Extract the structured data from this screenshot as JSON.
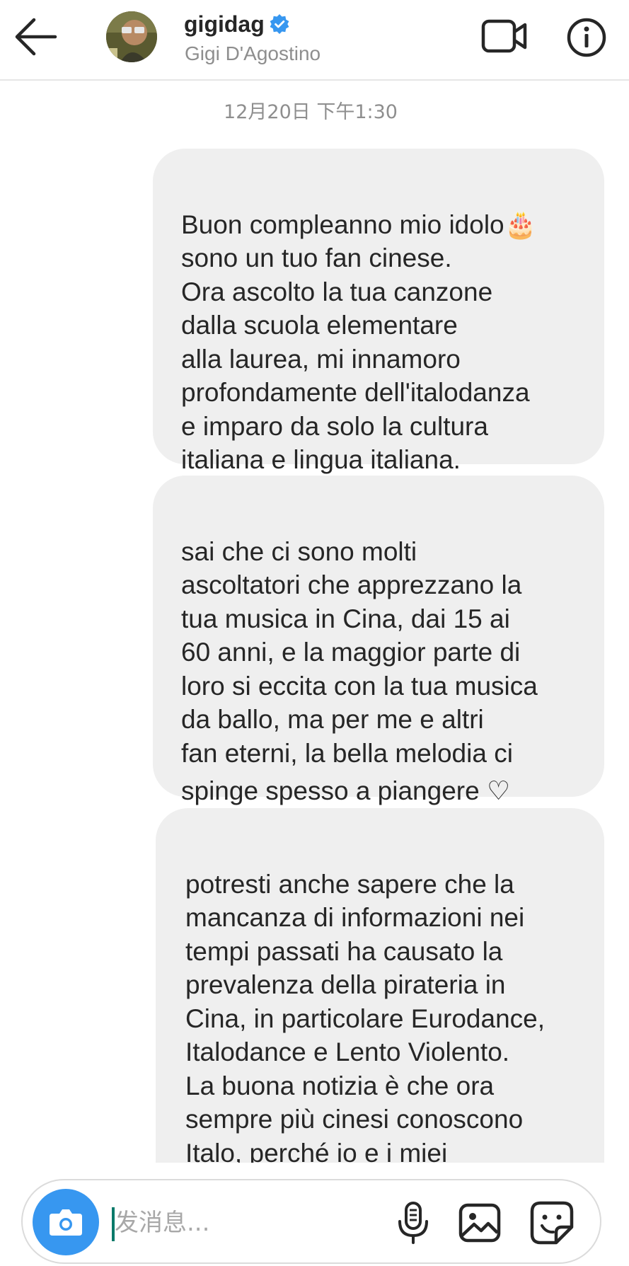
{
  "header": {
    "username": "gigidag",
    "full_name": "Gigi D'Agostino",
    "verified": true,
    "icons": {
      "back": "arrow-left-icon",
      "verified": "verified-badge-icon",
      "video_call": "video-camera-icon",
      "info": "info-icon"
    }
  },
  "thread": {
    "timestamp": "12月20日 下午1:30",
    "messages": [
      {
        "sender": "me",
        "text": "Buon compleanno mio idolo🎂\nsono un tuo fan cinese.\nOra ascolto la tua canzone\ndalla scuola elementare\nalla laurea, mi innamoro\nprofondamente dell'italodanza\ne imparo da solo la cultura\nitaliana e lingua italiana."
      },
      {
        "sender": "me",
        "text": "sai che ci sono molti\nascoltatori che apprezzano la\ntua musica in Cina, dai 15 ai\n60 anni, e la maggior parte di\nloro si eccita con la tua musica\nda ballo, ma per me e altri\nfan eterni, la bella melodia ci",
        "last_line": "spinge spesso a piangere ♡"
      },
      {
        "sender": "me",
        "text": "potresti anche sapere che la\nmancanza di informazioni nei\ntempi passati ha causato la\nprevalenza della pirateria in\nCina, in particolare Eurodance,\nItalodance e Lento Violento.\nLa buona notizia è che ora\nsempre più cinesi conoscono\nItalo, perché io e i miei\namici abbiamo corretto il"
      }
    ]
  },
  "composer": {
    "placeholder": "发消息...",
    "value": "",
    "icons": {
      "camera": "camera-icon",
      "mic": "microphone-icon",
      "gallery": "gallery-icon",
      "sticker": "sticker-icon"
    },
    "accent_color": "#3797f0"
  },
  "colors": {
    "bubble": "#efefef",
    "text": "#262626",
    "muted": "#8e8e8e",
    "verified": "#3797f0",
    "accent": "#3797f0"
  }
}
